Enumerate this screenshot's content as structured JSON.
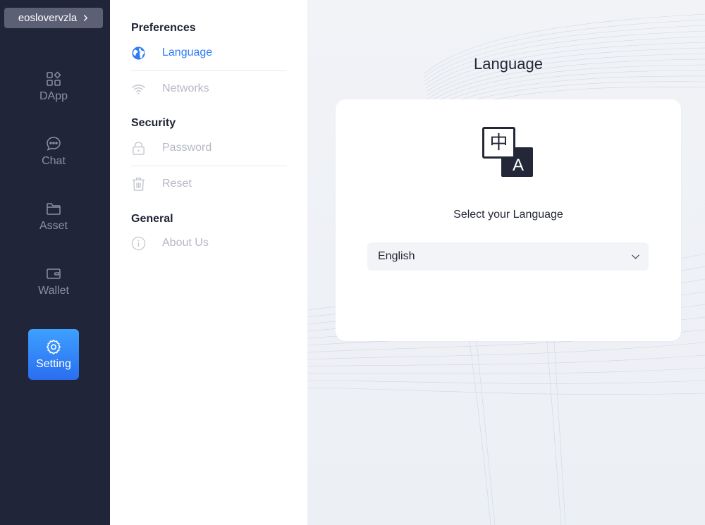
{
  "account": {
    "name": "eoslovervzla"
  },
  "nav": {
    "items": [
      {
        "key": "dapp",
        "label": "DApp",
        "icon": "dapp-grid-icon"
      },
      {
        "key": "chat",
        "label": "Chat",
        "icon": "chat-bubble-icon"
      },
      {
        "key": "asset",
        "label": "Asset",
        "icon": "folder-icon"
      },
      {
        "key": "wallet",
        "label": "Wallet",
        "icon": "wallet-icon"
      },
      {
        "key": "setting",
        "label": "Setting",
        "icon": "gear-icon",
        "active": true
      }
    ]
  },
  "menu": {
    "sections": {
      "preferences": "Preferences",
      "security": "Security",
      "general": "General"
    },
    "items": {
      "language": {
        "label": "Language",
        "icon": "globe-icon",
        "active": true
      },
      "networks": {
        "label": "Networks",
        "icon": "wifi-icon"
      },
      "password": {
        "label": "Password",
        "icon": "lock-icon"
      },
      "reset": {
        "label": "Reset",
        "icon": "trash-icon"
      },
      "about": {
        "label": "About Us",
        "icon": "info-icon"
      }
    }
  },
  "main": {
    "title": "Language",
    "card": {
      "icon_glyphs": {
        "top": "中",
        "bottom": "A"
      },
      "label": "Select your Language",
      "select": {
        "value": "English"
      }
    }
  },
  "colors": {
    "sidebar_bg": "#21253a",
    "accent": "#2f7cf6",
    "active_gradient_top": "#3ea0ff",
    "active_gradient_bottom": "#2a6ef0",
    "muted_text": "#b5b9c4"
  }
}
